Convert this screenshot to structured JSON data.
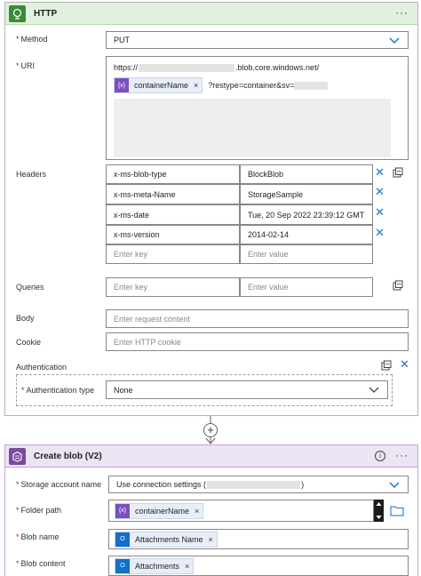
{
  "http_card": {
    "title": "HTTP",
    "method": {
      "label": "Method",
      "value": "PUT"
    },
    "uri": {
      "label": "URI",
      "prefix": "https://",
      "suffix": ".blob.core.windows.net/",
      "token_label": "containerName",
      "token_close": "×",
      "query": "?restype=container&sv="
    },
    "headers": {
      "label": "Headers",
      "rows": [
        {
          "key": "x-ms-blob-type",
          "value": "BlockBlob"
        },
        {
          "key": "x-ms-meta-Name",
          "value": "StorageSample"
        },
        {
          "key": "x-ms-date",
          "value": "Tue, 20 Sep 2022 23:39:12 GMT"
        },
        {
          "key": "x-ms-version",
          "value": "2014-02-14"
        }
      ],
      "key_placeholder": "Enter key",
      "value_placeholder": "Enter value"
    },
    "queries": {
      "label": "Queries",
      "key_placeholder": "Enter key",
      "value_placeholder": "Enter value"
    },
    "body": {
      "label": "Body",
      "placeholder": "Enter request content"
    },
    "cookie": {
      "label": "Cookie",
      "placeholder": "Enter HTTP cookie"
    },
    "authentication": {
      "label": "Authentication",
      "type_label": "Authentication type",
      "type_value": "None"
    }
  },
  "connector": {
    "plus": "+"
  },
  "blob_card": {
    "title": "Create blob (V2)",
    "info_glyph": "i",
    "more_glyph": "···",
    "storage_account": {
      "label": "Storage account name",
      "value": "Use connection settings (",
      "value_end": ")"
    },
    "folder_path": {
      "label": "Folder path",
      "token_label": "containerName",
      "token_close": "×"
    },
    "blob_name": {
      "label": "Blob name",
      "token_label": "Attachments Name",
      "token_close": "×"
    },
    "blob_content": {
      "label": "Blob content",
      "token_label": "Attachments",
      "token_close": "×"
    }
  },
  "colors": {
    "accent_blue": "#1976d2",
    "http_header": "#e2f0de",
    "blob_header": "#ece3f3",
    "required": "#a4262c"
  }
}
